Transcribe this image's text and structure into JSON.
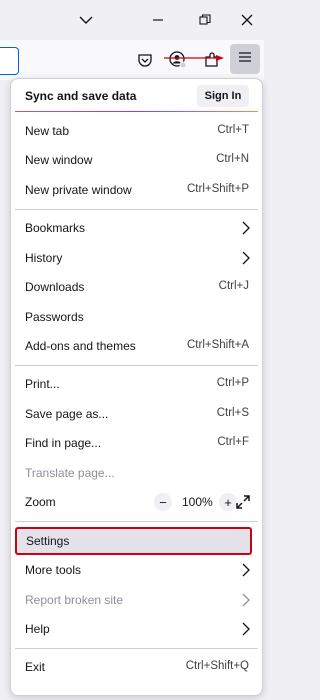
{
  "menu": {
    "sync_title": "Sync and save data",
    "sign_in": "Sign In",
    "new_tab": {
      "label": "New tab",
      "shortcut": "Ctrl+T"
    },
    "new_window": {
      "label": "New window",
      "shortcut": "Ctrl+N"
    },
    "new_private_window": {
      "label": "New private window",
      "shortcut": "Ctrl+Shift+P"
    },
    "bookmarks": {
      "label": "Bookmarks"
    },
    "history": {
      "label": "History"
    },
    "downloads": {
      "label": "Downloads",
      "shortcut": "Ctrl+J"
    },
    "passwords": {
      "label": "Passwords"
    },
    "addons": {
      "label": "Add-ons and themes",
      "shortcut": "Ctrl+Shift+A"
    },
    "print": {
      "label": "Print...",
      "shortcut": "Ctrl+P"
    },
    "save_page": {
      "label": "Save page as...",
      "shortcut": "Ctrl+S"
    },
    "find": {
      "label": "Find in page...",
      "shortcut": "Ctrl+F"
    },
    "translate": {
      "label": "Translate page..."
    },
    "zoom": {
      "label": "Zoom",
      "minus": "−",
      "value": "100%",
      "plus": "+"
    },
    "settings": {
      "label": "Settings"
    },
    "more_tools": {
      "label": "More tools"
    },
    "report_broken": {
      "label": "Report broken site"
    },
    "help": {
      "label": "Help"
    },
    "exit": {
      "label": "Exit",
      "shortcut": "Ctrl+Shift+Q"
    }
  },
  "icons": {
    "titlebar": [
      "chevron-down-icon",
      "minimize-icon",
      "restore-icon",
      "close-icon"
    ],
    "toolbar": [
      "pocket-icon",
      "account-icon",
      "extensions-icon",
      "hamburger-menu-icon"
    ]
  },
  "colors": {
    "highlight_border": "#cc0018",
    "annotation_arrow": "#cc0018",
    "menu_button_bg": "#cfcfd8",
    "sync_underline": "#c0339a"
  }
}
